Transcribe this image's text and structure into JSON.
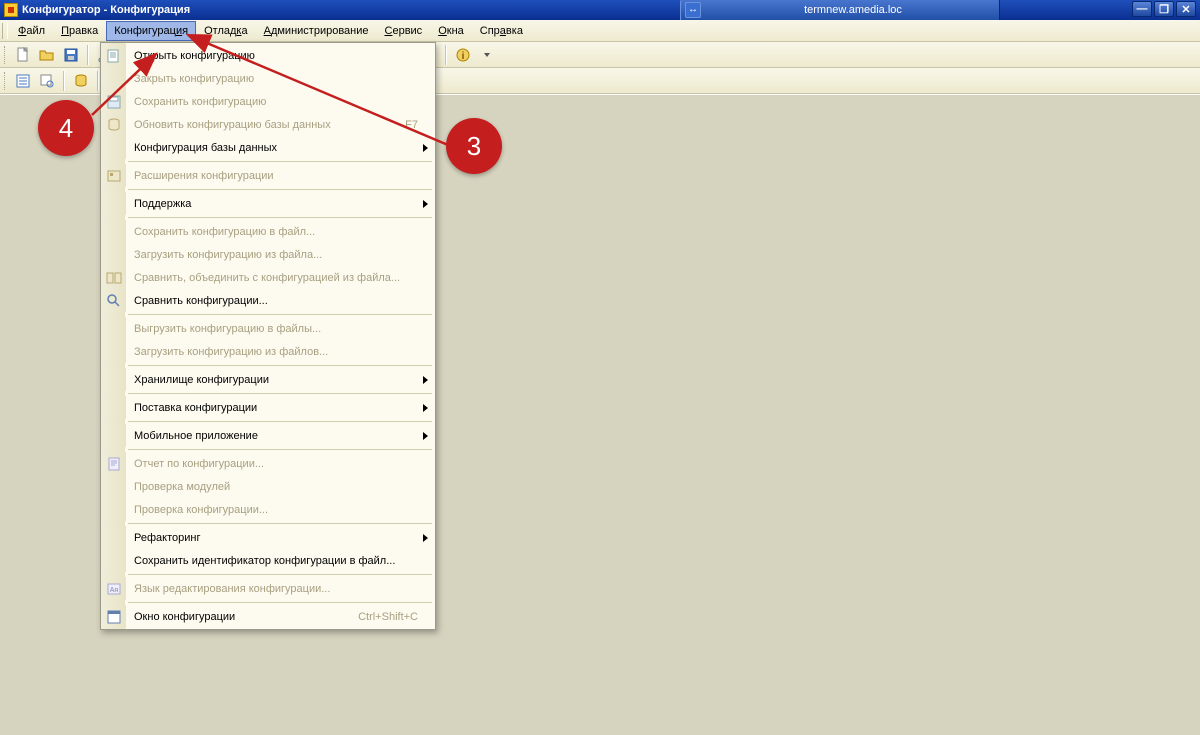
{
  "window": {
    "title": "Конфигуратор - Конфигурация",
    "tab_host": "termnew.amedia.loc"
  },
  "menubar": {
    "items": [
      {
        "label_pre": "",
        "u": "Ф",
        "label_post": "айл"
      },
      {
        "label_pre": "",
        "u": "П",
        "label_post": "равка"
      },
      {
        "label_pre": "Конфигурац",
        "u": "и",
        "label_post": "я",
        "active": true
      },
      {
        "label_pre": "Отлад",
        "u": "к",
        "label_post": "а"
      },
      {
        "label_pre": "",
        "u": "А",
        "label_post": "дминистрирование"
      },
      {
        "label_pre": "",
        "u": "С",
        "label_post": "ервис"
      },
      {
        "label_pre": "",
        "u": "О",
        "label_post": "кна"
      },
      {
        "label_pre": "Спр",
        "u": "а",
        "label_post": "вка"
      }
    ]
  },
  "dropdown": {
    "items": [
      {
        "type": "item",
        "label": "Открыть конфигурацию",
        "disabled": false,
        "icon": "open"
      },
      {
        "type": "item",
        "label": "Закрыть конфигурацию",
        "disabled": true,
        "icon": "none"
      },
      {
        "type": "item",
        "label": "Сохранить конфигурацию",
        "disabled": true,
        "icon": "save"
      },
      {
        "type": "item",
        "label": "Обновить конфигурацию базы данных",
        "disabled": true,
        "shortcut": "F7",
        "icon": "dbupdate"
      },
      {
        "type": "item",
        "label": "Конфигурация базы данных",
        "disabled": false,
        "submenu": true,
        "icon": "none"
      },
      {
        "type": "sep"
      },
      {
        "type": "item",
        "label": "Расширения конфигурации",
        "disabled": true,
        "icon": "ext"
      },
      {
        "type": "sep"
      },
      {
        "type": "item",
        "label": "Поддержка",
        "disabled": false,
        "submenu": true,
        "icon": "none"
      },
      {
        "type": "sep"
      },
      {
        "type": "item",
        "label": "Сохранить конфигурацию в файл...",
        "disabled": true,
        "icon": "none"
      },
      {
        "type": "item",
        "label": "Загрузить конфигурацию из файла...",
        "disabled": true,
        "icon": "none"
      },
      {
        "type": "item",
        "label": "Сравнить, объединить с конфигурацией из файла...",
        "disabled": true,
        "icon": "compare"
      },
      {
        "type": "item",
        "label": "Сравнить конфигурации...",
        "disabled": false,
        "icon": "magnify"
      },
      {
        "type": "sep"
      },
      {
        "type": "item",
        "label": "Выгрузить конфигурацию в файлы...",
        "disabled": true,
        "icon": "none"
      },
      {
        "type": "item",
        "label": "Загрузить конфигурацию из файлов...",
        "disabled": true,
        "icon": "none"
      },
      {
        "type": "sep"
      },
      {
        "type": "item",
        "label": "Хранилище конфигурации",
        "disabled": false,
        "submenu": true,
        "icon": "none"
      },
      {
        "type": "sep"
      },
      {
        "type": "item",
        "label": "Поставка конфигурации",
        "disabled": false,
        "submenu": true,
        "icon": "none"
      },
      {
        "type": "sep"
      },
      {
        "type": "item",
        "label": "Мобильное приложение",
        "disabled": false,
        "submenu": true,
        "icon": "none"
      },
      {
        "type": "sep"
      },
      {
        "type": "item",
        "label": "Отчет по конфигурации...",
        "disabled": true,
        "icon": "report"
      },
      {
        "type": "item",
        "label": "Проверка модулей",
        "disabled": true,
        "icon": "none"
      },
      {
        "type": "item",
        "label": "Проверка конфигурации...",
        "disabled": true,
        "icon": "none"
      },
      {
        "type": "sep"
      },
      {
        "type": "item",
        "label": "Рефакторинг",
        "disabled": false,
        "submenu": true,
        "icon": "none"
      },
      {
        "type": "item",
        "label": "Сохранить идентификатор конфигурации в файл...",
        "disabled": false,
        "icon": "none"
      },
      {
        "type": "sep"
      },
      {
        "type": "item",
        "label": "Язык редактирования конфигурации...",
        "disabled": true,
        "icon": "lang"
      },
      {
        "type": "sep"
      },
      {
        "type": "item",
        "label": "Окно конфигурации",
        "disabled": false,
        "shortcut": "Ctrl+Shift+C",
        "shortcut_enabled": false,
        "icon": "window"
      }
    ]
  },
  "annotations": {
    "badge3": "3",
    "badge4": "4"
  }
}
